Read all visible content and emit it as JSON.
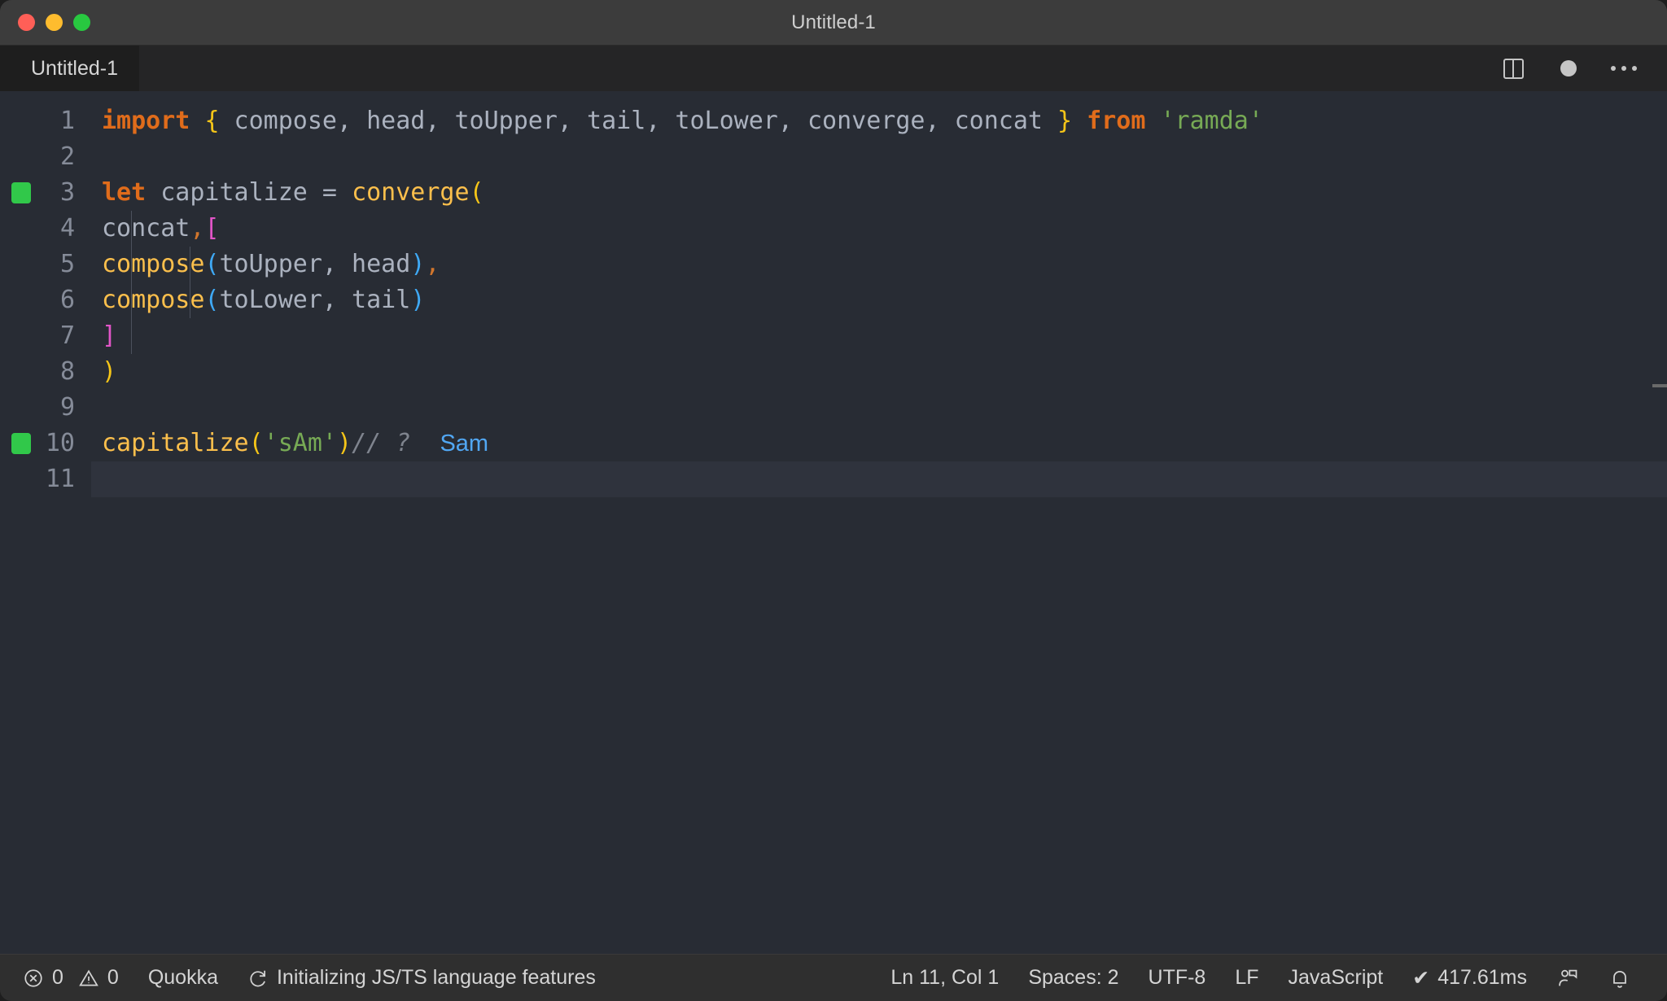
{
  "window": {
    "title": "Untitled-1",
    "traffic_lights": [
      "close-button",
      "minimize-button",
      "maximize-button"
    ]
  },
  "tabbar": {
    "tab_label": "Untitled-1",
    "actions": [
      {
        "name": "split-editor-icon",
        "label": "split-editor"
      },
      {
        "name": "unsaved-indicator",
        "label": "unsaved"
      },
      {
        "name": "more-actions-icon",
        "label": "..."
      }
    ]
  },
  "editor": {
    "language": "javascript",
    "lines": [
      {
        "no": "1",
        "marker": false
      },
      {
        "no": "2",
        "marker": false
      },
      {
        "no": "3",
        "marker": true
      },
      {
        "no": "4",
        "marker": false
      },
      {
        "no": "5",
        "marker": false
      },
      {
        "no": "6",
        "marker": false
      },
      {
        "no": "7",
        "marker": false
      },
      {
        "no": "8",
        "marker": false
      },
      {
        "no": "9",
        "marker": false
      },
      {
        "no": "10",
        "marker": true
      },
      {
        "no": "11",
        "marker": false
      }
    ],
    "code": {
      "l1_import": "import",
      "l1_open": "{",
      "l1_names": " compose, head, toUpper, tail, toLower, converge, concat ",
      "l1_close": "}",
      "l1_from": "from",
      "l1_module": "'ramda'",
      "l3_let": "let",
      "l3_name": " capitalize = ",
      "l3_fn": "converge",
      "l3_paren": "(",
      "l4_concat": "concat",
      "l4_comma": ",",
      "l4_bracket": "[",
      "l5_fn": "compose",
      "l5_args": "toUpper, head",
      "l6_fn": "compose",
      "l6_args": "toLower, tail",
      "l7_bracket": "]",
      "l8_paren": ")",
      "l10_fn": "capitalize",
      "l10_arg": "'sAm'",
      "l10_comment": "// ?",
      "l10_value": "Sam"
    }
  },
  "statusbar": {
    "errors": "0",
    "warnings": "0",
    "quokka": "Quokka",
    "task": "Initializing JS/TS language features",
    "cursor": "Ln 11, Col 1",
    "indent": "Spaces: 2",
    "encoding": "UTF-8",
    "eol": "LF",
    "language": "JavaScript",
    "runtime": "417.61ms",
    "runtime_check": "✔",
    "icons": [
      "error-icon",
      "warning-icon",
      "sync-icon",
      "check-icon",
      "remote-feedback-icon",
      "bell-icon"
    ]
  },
  "colors": {
    "editor_bg": "#282c34",
    "titlebar_bg": "#3c3c3c",
    "tabbar_bg": "#252526",
    "statusbar_bg": "#2f2f2f",
    "keyword": "#e06c1b",
    "function": "#fbbf4c",
    "string": "#77aa55",
    "bracket_pink": "#e255c8",
    "paren_yellow": "#f5c518",
    "paren_blue": "#3fa9f5",
    "quokka_value": "#51a7f3",
    "marker_green": "#31c84a"
  }
}
